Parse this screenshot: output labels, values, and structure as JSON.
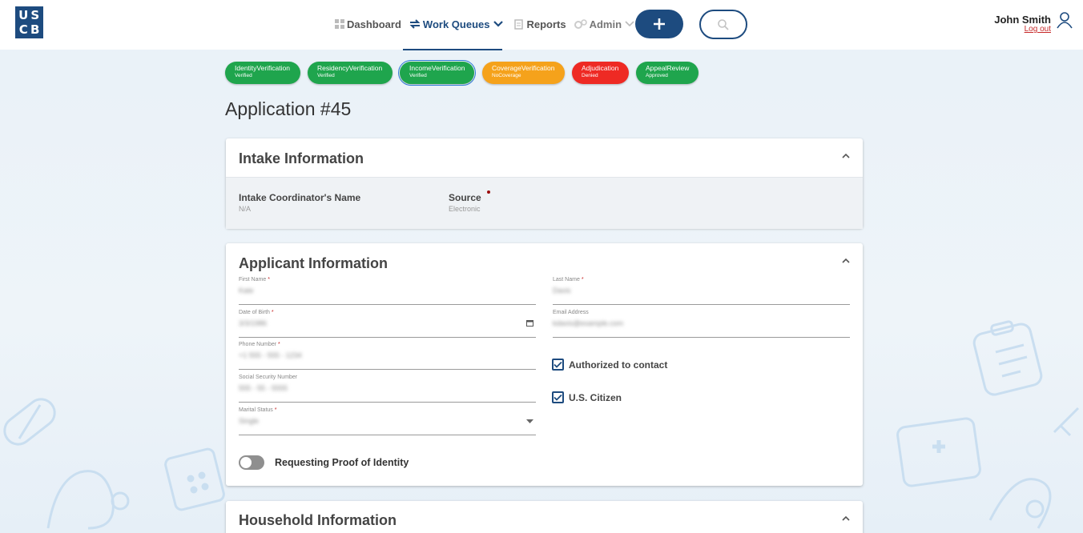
{
  "logo": {
    "letters": [
      "U",
      "S",
      "C",
      "B"
    ]
  },
  "nav": {
    "items": [
      {
        "label": "Dashboard",
        "icon": "dashboard-icon"
      },
      {
        "label": "Work Queues",
        "icon": "queue-icon",
        "active": true
      },
      {
        "label": "Reports",
        "icon": "reports-icon"
      },
      {
        "label": "Admin",
        "icon": "gear-icon"
      }
    ]
  },
  "user": {
    "name": "John Smith",
    "logout": "Log out"
  },
  "statuses": [
    {
      "title": "IdentityVerification",
      "sub": "Verified",
      "color": "green"
    },
    {
      "title": "ResidencyVerification",
      "sub": "Verified",
      "color": "green"
    },
    {
      "title": "IncomeVerification",
      "sub": "Verified",
      "color": "green",
      "selected": true
    },
    {
      "title": "CoverageVerification",
      "sub": "NoCoverage",
      "color": "orange"
    },
    {
      "title": "Adjudication",
      "sub": "Denied",
      "color": "red"
    },
    {
      "title": "AppealReview",
      "sub": "Approved",
      "color": "green"
    }
  ],
  "page_title": "Application #45",
  "intake": {
    "title": "Intake Information",
    "coordinator_label": "Intake Coordinator's Name",
    "coordinator_value": "N/A",
    "source_label": "Source",
    "source_value": "Electronic"
  },
  "applicant": {
    "title": "Applicant Information",
    "first_name": {
      "label": "First Name",
      "value": "Kate"
    },
    "last_name": {
      "label": "Last Name",
      "value": "Davis"
    },
    "dob": {
      "label": "Date of Birth",
      "value": "3/3/1986"
    },
    "email": {
      "label": "Email Address",
      "value": "kdavis@example.com"
    },
    "phone": {
      "label": "Phone Number",
      "value": "+1 555 - 555 - 1234"
    },
    "ssn": {
      "label": "Social Security Number",
      "value": "555 - 55 - 5555"
    },
    "marital": {
      "label": "Marital Status",
      "value": "Single"
    },
    "authorized_label": "Authorized to contact",
    "citizen_label": "U.S. Citizen",
    "proof_label": "Requesting Proof of Identity"
  },
  "household": {
    "title": "Household Information"
  },
  "colors": {
    "brand": "#1d4b7f",
    "green": "#1fa54d",
    "orange": "#f5a21b",
    "red": "#ee2a24"
  }
}
